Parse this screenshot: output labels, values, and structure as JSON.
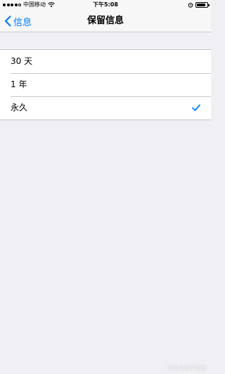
{
  "status_bar": {
    "carrier": "中国移动",
    "time": "下午5:08",
    "signal_bars": 5,
    "signal_filled": 4,
    "battery_level": 0.85
  },
  "nav": {
    "back_label": "信息",
    "title": "保留信息"
  },
  "options": [
    {
      "label": "30 天",
      "selected": false
    },
    {
      "label": "1 年",
      "selected": false
    },
    {
      "label": "永久",
      "selected": true
    }
  ],
  "colors": {
    "accent": "#007aff",
    "background": "#efeff4"
  },
  "watermark": "头条号@手机客"
}
